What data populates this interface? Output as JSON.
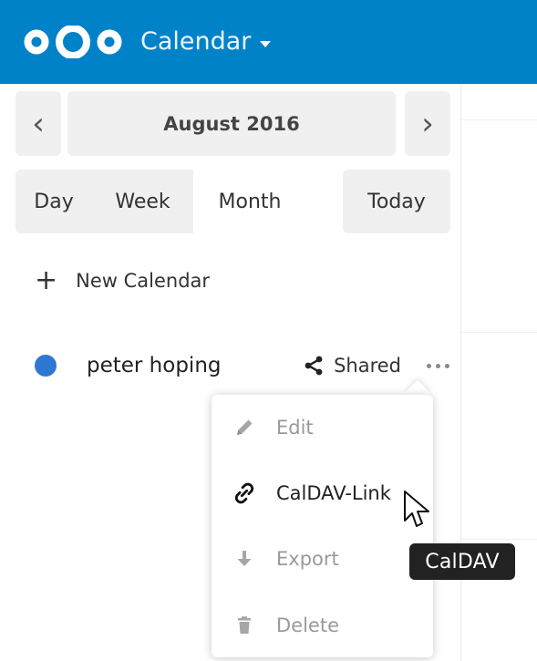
{
  "header": {
    "app_name": "Calendar"
  },
  "navigation": {
    "current_period": "August 2016",
    "views": [
      {
        "label": "Day"
      },
      {
        "label": "Week"
      },
      {
        "label": "Month"
      }
    ],
    "today_label": "Today"
  },
  "sidebar": {
    "new_calendar_label": "New Calendar",
    "calendar": {
      "name": "peter hoping",
      "shared_label": "Shared",
      "color": "#2f78d1"
    }
  },
  "menu": {
    "items": [
      {
        "label": "Edit",
        "icon": "pencil-icon",
        "enabled": false
      },
      {
        "label": "CalDAV-Link",
        "icon": "link-icon",
        "enabled": true
      },
      {
        "label": "Export",
        "icon": "download-icon",
        "enabled": false
      },
      {
        "label": "Delete",
        "icon": "trash-icon",
        "enabled": false
      }
    ]
  },
  "tooltip": {
    "text": "CalDAV"
  },
  "colors": {
    "header": "#0082c9",
    "button_bg": "#f0f0f0",
    "calendar_dot": "#2f78d1",
    "tooltip_bg": "#222222"
  }
}
